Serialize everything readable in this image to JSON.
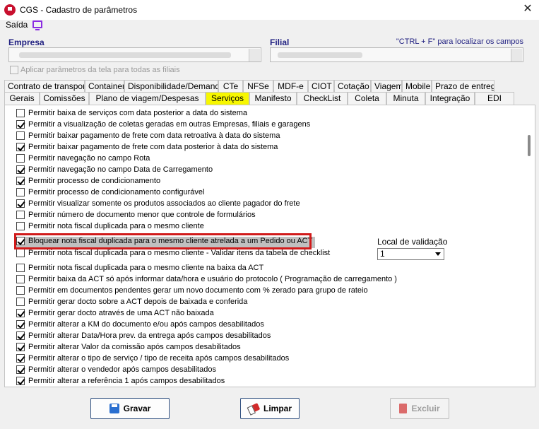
{
  "window": {
    "title": "CGS - Cadastro de parâmetros",
    "close_glyph": "✕"
  },
  "menu": {
    "saida": "Saída",
    "icon": "monitor-icon"
  },
  "form": {
    "empresa_label": "Empresa",
    "filial_label": "Filial",
    "hint": "\"CTRL + F\" para localizar os campos",
    "apply_all": "Aplicar parâmetros da tela para todas as filiais"
  },
  "tabs_row1": [
    "Contrato de transporte",
    "Container",
    "Disponibilidade/Demanda",
    "CTe",
    "NFSe",
    "MDF-e",
    "CIOT",
    "Cotação",
    "Viagem",
    "Mobile",
    "Prazo de entrega"
  ],
  "tabs_row2": [
    "Gerais",
    "Comissões",
    "Plano de viagem/Despesas",
    "Serviços",
    "Manifesto",
    "CheckList",
    "Coleta",
    "Minuta",
    "Integração",
    "EDI"
  ],
  "active_tab": "Serviços",
  "options": [
    {
      "label": "Permitir baixa de serviços com data posterior a data do sistema",
      "checked": false
    },
    {
      "label": "Permitir a visualização de coletas geradas em outras Empresas, filiais e garagens",
      "checked": true
    },
    {
      "label": "Permitir baixar pagamento de frete com data retroativa à data do sistema",
      "checked": false
    },
    {
      "label": "Permitir baixar pagamento de frete com data posterior à data do sistema",
      "checked": true
    },
    {
      "label": "Permitir navegação no campo Rota",
      "checked": false
    },
    {
      "label": "Permitir navegação no campo Data de Carregamento",
      "checked": true
    },
    {
      "label": "Permitir processo de condicionamento",
      "checked": true
    },
    {
      "label": "Permitir processo de condicionamento configurável",
      "checked": false
    },
    {
      "label": "Permitir visualizar somente os produtos associados ao cliente pagador do frete",
      "checked": true
    },
    {
      "label": "Permitir número de documento menor que controle de formulários",
      "checked": false
    },
    {
      "label": "Permitir nota fiscal duplicada para o mesmo cliente",
      "checked": false
    },
    {
      "label": "Bloquear nota fiscal duplicada para o mesmo cliente atrelada a um Pedido ou ACT",
      "checked": true
    },
    {
      "label": "Permitir nota fiscal duplicada para o mesmo cliente - Validar itens da tabela de checklist",
      "checked": false
    },
    {
      "label": "Permitir nota fiscal duplicada para o mesmo cliente na baixa da ACT",
      "checked": false
    },
    {
      "label": "Permitir baixa da ACT só após informar data/hora e usuário do protocolo ( Programação de carregamento )",
      "checked": false
    },
    {
      "label": "Permitir em documentos pendentes gerar um novo documento com % zerado para grupo de rateio",
      "checked": false
    },
    {
      "label": "Permitir gerar docto sobre a ACT depois de baixada e conferida",
      "checked": false
    },
    {
      "label": "Permitir gerar docto através de uma ACT não baixada",
      "checked": true
    },
    {
      "label": "Permitir alterar a KM do documento e/ou após campos desabilitados",
      "checked": true
    },
    {
      "label": "Permitir alterar Data/Hora prev. da entrega após campos desabilitados",
      "checked": true
    },
    {
      "label": "Permitir alterar Valor da comissão após campos desabilitados",
      "checked": true
    },
    {
      "label": "Permitir alterar o tipo de serviço / tipo de receita após campos desabilitados",
      "checked": true
    },
    {
      "label": "Permitir alterar o vendedor após campos desabilitados",
      "checked": true
    },
    {
      "label": "Permitir alterar a referência 1 após campos desabilitados",
      "checked": true
    }
  ],
  "local_validacao": {
    "label": "Local de validação",
    "value": "1"
  },
  "buttons": {
    "gravar": "Gravar",
    "limpar": "Limpar",
    "excluir": "Excluir"
  }
}
